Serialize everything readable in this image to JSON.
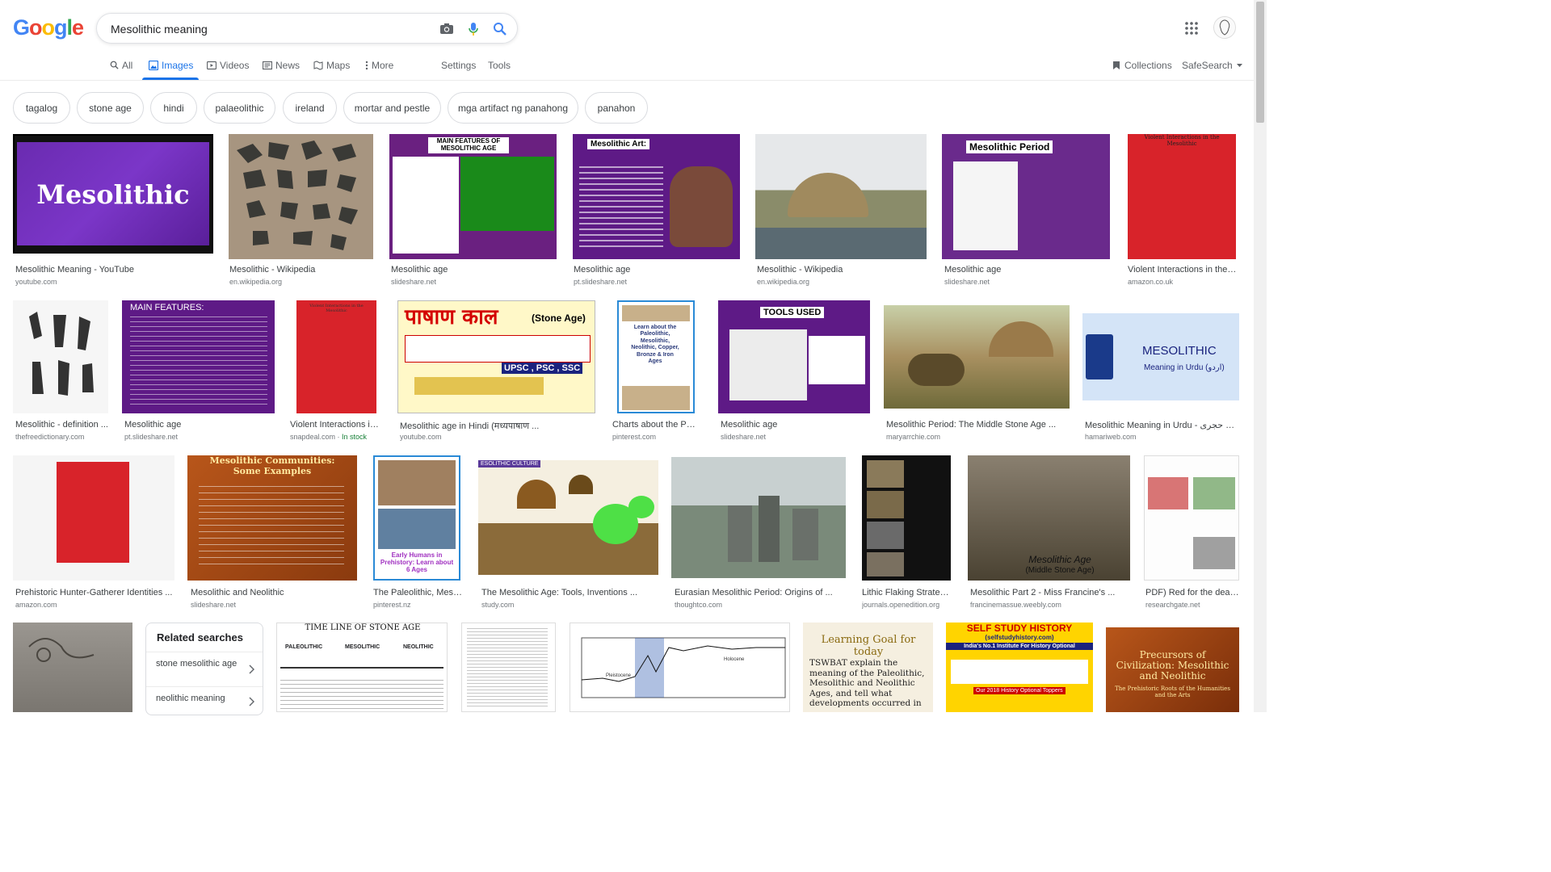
{
  "brand": {
    "logo_letters": [
      {
        "ch": "G",
        "color": "#4285F4"
      },
      {
        "ch": "o",
        "color": "#EA4335"
      },
      {
        "ch": "o",
        "color": "#FBBC05"
      },
      {
        "ch": "g",
        "color": "#4285F4"
      },
      {
        "ch": "l",
        "color": "#34A853"
      },
      {
        "ch": "e",
        "color": "#EA4335"
      }
    ]
  },
  "search": {
    "query": "Mesolithic meaning"
  },
  "tabs": [
    {
      "label": "All",
      "icon": "search-icon"
    },
    {
      "label": "Images",
      "icon": "image-icon",
      "active": true
    },
    {
      "label": "Videos",
      "icon": "video-icon"
    },
    {
      "label": "News",
      "icon": "news-icon"
    },
    {
      "label": "Maps",
      "icon": "map-icon"
    },
    {
      "label": "More",
      "icon": "more-icon"
    }
  ],
  "tools": {
    "settings": "Settings",
    "tools": "Tools",
    "collections": "Collections",
    "safesearch": "SafeSearch"
  },
  "chips": [
    "tagalog",
    "stone age",
    "hindi",
    "palaeolithic",
    "ireland",
    "mortar and pestle",
    "mga artifact ng panahong",
    "panahon"
  ],
  "results_row1": [
    {
      "title": "Mesolithic Meaning - YouTube",
      "source": "youtube.com",
      "thumb_text": "Mesolithic"
    },
    {
      "title": "Mesolithic - Wikipedia",
      "source": "en.wikipedia.org"
    },
    {
      "title": "Mesolithic age",
      "source": "slideshare.net",
      "thumb_text": "MAIN FEATURES OF MESOLITHIC AGE"
    },
    {
      "title": "Mesolithic age",
      "source": "pt.slideshare.net",
      "thumb_text": "Mesolithic Art:"
    },
    {
      "title": "Mesolithic - Wikipedia",
      "source": "en.wikipedia.org"
    },
    {
      "title": "Mesolithic age",
      "source": "slideshare.net",
      "thumb_text": "Mesolithic Period"
    },
    {
      "title": "Violent Interactions in the M...",
      "source": "amazon.co.uk",
      "thumb_text": "Violent Interactions in the Mesolithic"
    }
  ],
  "results_row2": [
    {
      "title": "Mesolithic - definition ...",
      "source": "thefreedictionary.com"
    },
    {
      "title": "Mesolithic age",
      "source": "pt.slideshare.net",
      "thumb_text": "MAIN FEATURES:"
    },
    {
      "title": "Violent Interactions in t...",
      "source": "snapdeal.com",
      "stock": "In stock",
      "thumb_text": "Violent Interactions in the Mesolithic"
    },
    {
      "title": "Mesolithic age in Hindi (मध्यपाषाण ...",
      "source": "youtube.com",
      "thumb_text": "पाषाण काल",
      "thumb_text2": "(Stone Age)",
      "thumb_text3": "UPSC , PSC , SSC"
    },
    {
      "title": "Charts about the Pale...",
      "source": "pinterest.com",
      "thumb_text": "Learn about the Paleolithic, Mesolithic, Neolithic, Copper, Bronze & Iron Ages"
    },
    {
      "title": "Mesolithic age",
      "source": "slideshare.net",
      "thumb_text": "TOOLS USED"
    },
    {
      "title": "Mesolithic Period: The Middle Stone Age ...",
      "source": "maryarrchie.com"
    },
    {
      "title": "Mesolithic Meaning in Urdu - میان حجری ...",
      "source": "hamariweb.com",
      "thumb_text": "MESOLITHIC",
      "thumb_text2": "Meaning in Urdu (اردو)"
    }
  ],
  "results_row3": [
    {
      "title": "Prehistoric Hunter-Gatherer Identities ...",
      "source": "amazon.com"
    },
    {
      "title": "Mesolithic and Neolithic",
      "source": "slideshare.net",
      "thumb_text": "Mesolithic Communities: Some Examples"
    },
    {
      "title": "The Paleolithic, Mesoli...",
      "source": "pinterest.nz",
      "thumb_text": "Early Humans in Prehistory: Learn about 6 Ages"
    },
    {
      "title": "The Mesolithic Age: Tools, Inventions ...",
      "source": "study.com",
      "thumb_text": "ESOLITHIC CULTURE"
    },
    {
      "title": "Eurasian Mesolithic Period: Origins of ...",
      "source": "thoughtco.com"
    },
    {
      "title": "Lithic Flaking Strategi...",
      "source": "journals.openedition.org"
    },
    {
      "title": "Mesolithic Part 2 - Miss Francine's ...",
      "source": "francinemassue.weebly.com",
      "thumb_text": "Mesolithic Age",
      "thumb_text2": "(Middle Stone Age)"
    },
    {
      "title": "PDF) Red for the dead...",
      "source": "researchgate.net"
    }
  ],
  "related": {
    "heading": "Related searches",
    "items": [
      "stone mesolithic age",
      "neolithic meaning"
    ]
  },
  "row4_thumbs": {
    "timeline_title": "TIME LINE OF STONE AGE",
    "timeline_cols": [
      "PALEOLITHIC",
      "MESOLITHIC",
      "NEOLITHIC"
    ],
    "goal_title": "Learning Goal for today",
    "goal_text": "TSWBAT explain the meaning of the Paleolithic, Mesolithic and Neolithic Ages, and tell what developments occurred in",
    "ssh_title": "SELF STUDY HISTORY",
    "ssh_url": "(selfstudyhistory.com)",
    "ssh_tag": "India's No.1 Institute For History Optional",
    "ssh_sub": "Our 2018 History Optional Toppers",
    "precursors": "Precursors of Civilization: Mesolithic and Neolithic",
    "precursors_sub": "The Prehistoric Roots of the Humanities and the Arts",
    "climate_labels": [
      "Pleistocene",
      "Holocene"
    ]
  }
}
